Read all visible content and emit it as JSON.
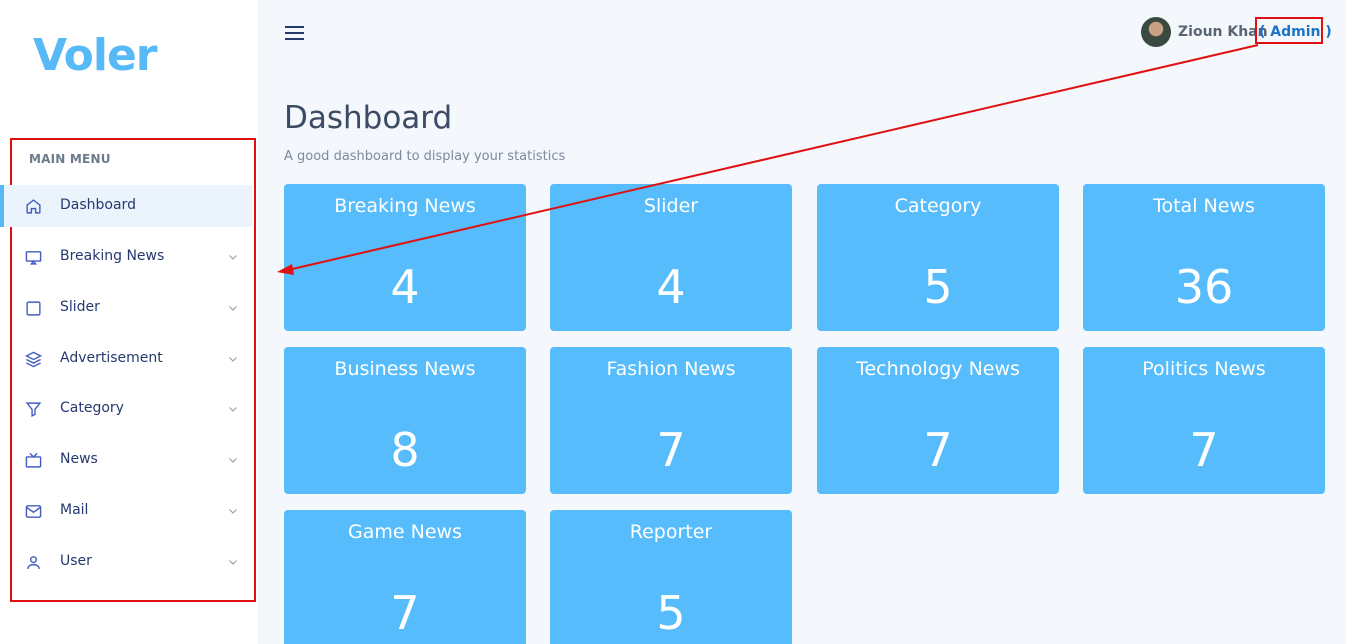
{
  "brand": {
    "logo_text": "Voler",
    "accent": "#57b9f6"
  },
  "sidebar": {
    "menu_title": "MAIN MENU",
    "items": [
      {
        "label": "Dashboard",
        "icon": "home-icon",
        "active": true
      },
      {
        "label": "Breaking News",
        "icon": "monitor-icon"
      },
      {
        "label": "Slider",
        "icon": "square-icon"
      },
      {
        "label": "Advertisement",
        "icon": "layers-icon"
      },
      {
        "label": "Category",
        "icon": "filter-icon"
      },
      {
        "label": "News",
        "icon": "tv-icon"
      },
      {
        "label": "Mail",
        "icon": "mail-icon"
      },
      {
        "label": "User",
        "icon": "user-icon"
      }
    ]
  },
  "header": {
    "user_name": "Zioun Khan",
    "user_role": "( Admin )"
  },
  "main": {
    "title": "Dashboard",
    "subtitle": "A good dashboard to display your statistics",
    "cards": [
      {
        "title": "Breaking News",
        "value": "4"
      },
      {
        "title": "Slider",
        "value": "4"
      },
      {
        "title": "Category",
        "value": "5"
      },
      {
        "title": "Total News",
        "value": "36"
      },
      {
        "title": "Business News",
        "value": "8"
      },
      {
        "title": "Fashion News",
        "value": "7"
      },
      {
        "title": "Technology News",
        "value": "7"
      },
      {
        "title": "Politics News",
        "value": "7"
      },
      {
        "title": "Game News",
        "value": "7"
      },
      {
        "title": "Reporter",
        "value": "5"
      }
    ]
  },
  "colors": {
    "card": "#57bcfb",
    "annotation": "#e01010"
  }
}
